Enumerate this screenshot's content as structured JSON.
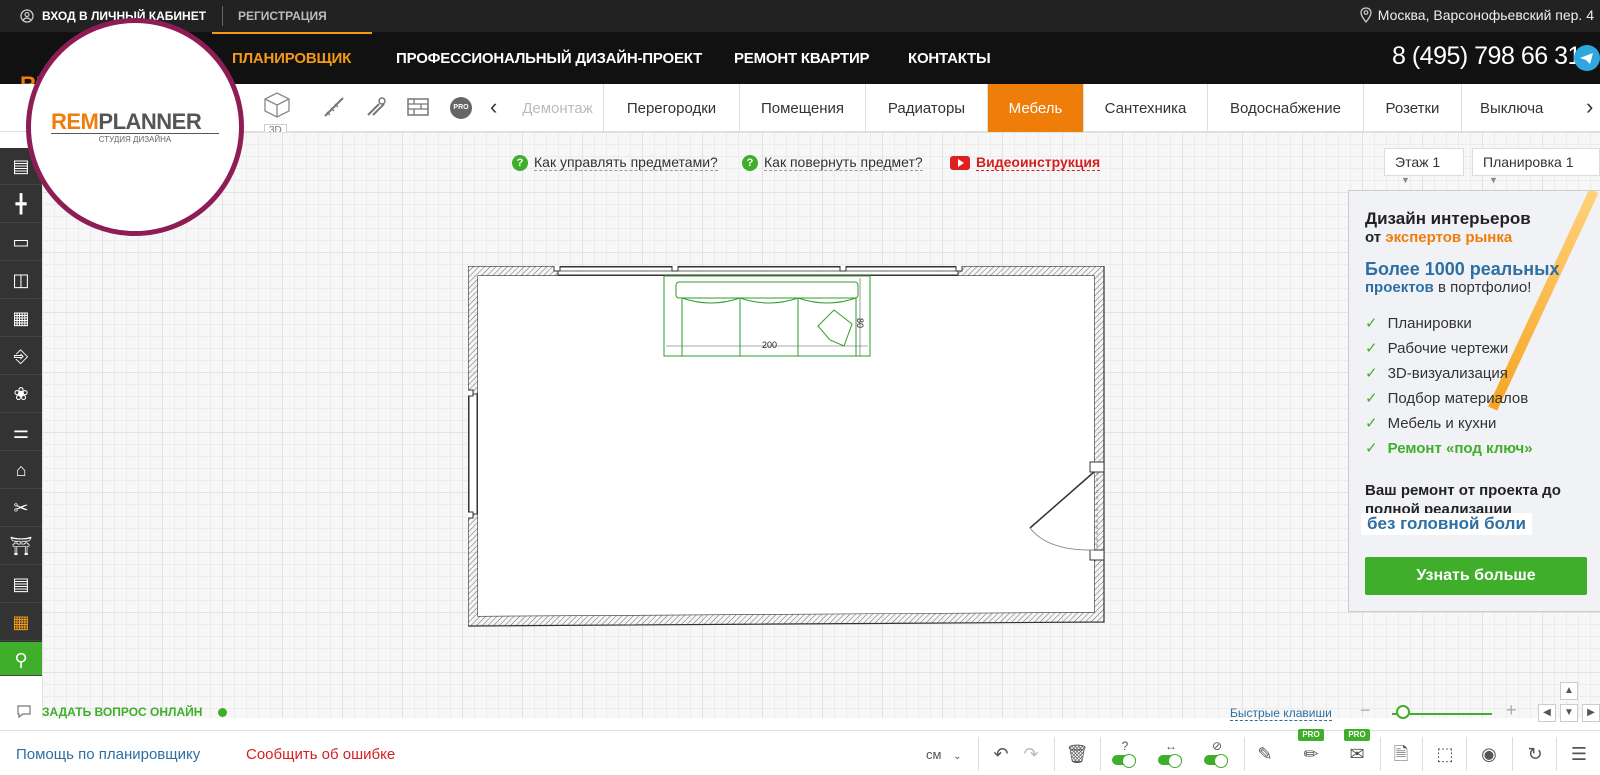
{
  "topbar": {
    "login": "ВХОД В ЛИЧНЫЙ КАБИНЕТ",
    "register": "РЕГИСТРАЦИЯ",
    "address": "Москва, Варсонофьевский пер. 4"
  },
  "nav": {
    "items": [
      "ПЛАНИРОВЩИК",
      "ПРОФЕССИОНАЛЬНЫЙ ДИЗАЙН-ПРОЕКТ",
      "РЕМОНТ КВАРТИР",
      "КОНТАКТЫ"
    ],
    "active": "ПЛАНИРОВЩИК",
    "phone": "8 (495) 798 66 31"
  },
  "logo": {
    "brand_orange": "REM",
    "brand_gray": "PLANNER",
    "subtitle": "СТУДИЯ ДИЗАЙНА",
    "peek": "REM"
  },
  "toolbar": {
    "view_3d": "3D",
    "pro": "PRO",
    "categories": [
      "Демонтаж",
      "Перегородки",
      "Помещения",
      "Радиаторы",
      "Мебель",
      "Сантехника",
      "Водоснабжение",
      "Розетки",
      "Выключа"
    ],
    "active_category": "Мебель"
  },
  "help": {
    "manage": "Как управлять предметами?",
    "rotate": "Как повернуть предмет?",
    "video": "Видеоинструкция"
  },
  "selectors": {
    "floor": "Этаж 1",
    "plan": "Планировка 1"
  },
  "plan": {
    "sofa_width": "200",
    "sofa_depth": "80"
  },
  "ad": {
    "title1": "Дизайн интерьеров",
    "title2_prefix": "от",
    "title2_accent": "экспертов рынка",
    "count": "Более 1000 реальных",
    "count2_accent": "проектов",
    "count2_rest": "в портфолио!",
    "features": [
      "Планировки",
      "Рабочие чертежи",
      "3D-визуализация",
      "Подбор материалов",
      "Мебель и кухни",
      "Ремонт «под ключ»"
    ],
    "tagline": "Ваш ремонт от проекта до полной реализации",
    "tagline_accent": "без головной боли",
    "cta": "Узнать больше"
  },
  "footer": {
    "ask": "ЗАДАТЬ ВОПРОС ОНЛАЙН",
    "hotkeys": "Быстрые клавиши",
    "help": "Помощь по планировщику",
    "report": "Сообщить об ошибке",
    "unit": "см",
    "pro": "PRO"
  },
  "colors": {
    "accent": "#ef7d0a",
    "green": "#3fae2a",
    "link_blue": "#2d6fa3",
    "error_red": "#d61f1f",
    "logo_ring": "#8e1d55"
  }
}
